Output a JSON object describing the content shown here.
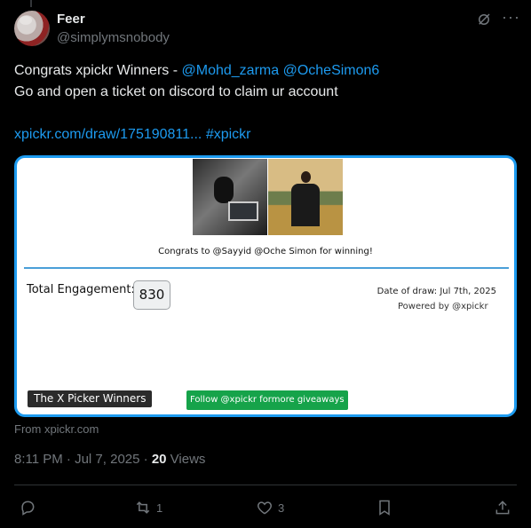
{
  "author": {
    "display_name": "Feer",
    "handle": "@simplymsnobody"
  },
  "tweet": {
    "text_prefix": "Congrats xpickr Winners - ",
    "mention_1": "@Mohd_zarma",
    "mention_2": "@OcheSimon6",
    "line_2": "Go and open a ticket on discord to claim ur account",
    "link": "xpickr.com/draw/175190811...",
    "hashtag": "#xpickr"
  },
  "card": {
    "congrats_text": "Congrats to @Sayyid @Oche Simon for winning!",
    "engagement_label": "Total Engagement:",
    "engagement_value": "830",
    "draw_date": "Date of draw: Jul 7th, 2025",
    "powered_by": "Powered by @xpickr",
    "winners_badge": "The X Picker Winners",
    "follow_button": "Follow @xpickr formore giveaways",
    "source": "From xpickr.com"
  },
  "meta": {
    "timestamp": "8:11 PM · Jul 7, 2025 · ",
    "views_count": "20",
    "views_label": " Views"
  },
  "actions": {
    "reply_count": "",
    "retweet_count": "1",
    "like_count": "3"
  },
  "colors": {
    "accent": "#1d9bf0",
    "background": "#000000",
    "muted": "#71767b",
    "follow_green": "#16a34a"
  },
  "icons": [
    "more-icon",
    "grok-icon",
    "reply-icon",
    "retweet-icon",
    "like-icon",
    "bookmark-icon",
    "share-icon"
  ]
}
